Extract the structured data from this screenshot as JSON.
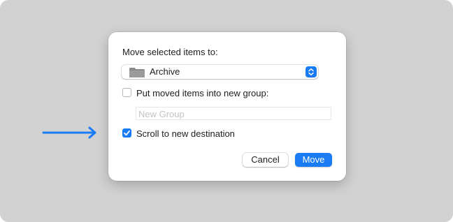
{
  "dialog": {
    "prompt_label": "Move selected items to:",
    "destination": {
      "selected": "Archive",
      "icon": "folder-icon"
    },
    "group_option": {
      "label": "Put moved items into new group:",
      "checked": false,
      "field_placeholder": "New Group",
      "field_value": ""
    },
    "scroll_option": {
      "label": "Scroll to new destination",
      "checked": true
    },
    "buttons": {
      "cancel": "Cancel",
      "move": "Move"
    }
  },
  "annotation": {
    "icon": "arrow-right-icon",
    "color": "#1a7cf5"
  },
  "colors": {
    "accent": "#1a7cf5",
    "backdrop": "#d2d2d2",
    "dialog": "#ffffff"
  }
}
